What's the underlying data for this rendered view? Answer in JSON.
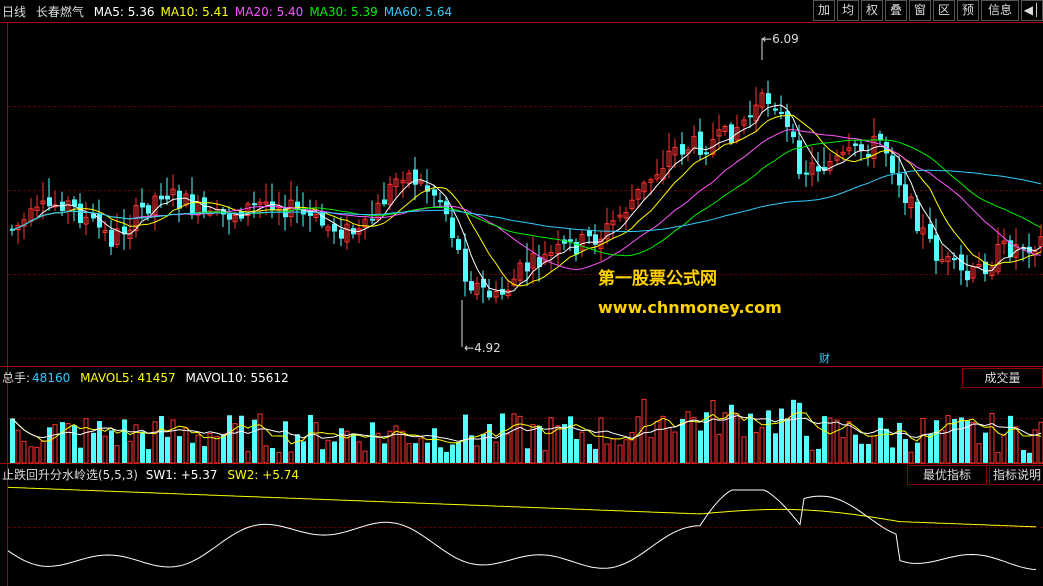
{
  "header": {
    "period": "日线",
    "stock_name": "长春燃气",
    "ma": [
      {
        "label": "MA5: 5.36",
        "color": "#ffffff"
      },
      {
        "label": "MA10: 5.41",
        "color": "#ffff00"
      },
      {
        "label": "MA20: 5.40",
        "color": "#ff55ff"
      },
      {
        "label": "MA30: 5.39",
        "color": "#00ee00"
      },
      {
        "label": "MA60: 5.64",
        "color": "#33ccff"
      }
    ]
  },
  "toolbar": [
    "加",
    "均",
    "权",
    "叠",
    "窗",
    "区",
    "预",
    "信息"
  ],
  "toolbar_exit_icon": "exit-icon",
  "price_chart": {
    "high_label": "6.09",
    "low_label": "4.92",
    "finance_marker": "财"
  },
  "watermark": {
    "line1": "第一股票公式网",
    "line2": "www.chnmoney.com"
  },
  "volume_panel": {
    "total_label": "总手:",
    "total_value": "48160",
    "mavol5": "MAVOL5: 41457",
    "mavol10": "MAVOL10: 55612",
    "button": "成交量"
  },
  "indicator_panel": {
    "name": "止跌回升分水岭选(5,5,3)",
    "sw1": "SW1: +5.37",
    "sw2": "SW2: +5.74",
    "button_best": "最优指标",
    "button_help": "指标说明"
  },
  "colors": {
    "up": "#ff3232",
    "down": "#54ffff",
    "grid": "#5a0000",
    "separator": "#aa0000"
  }
}
